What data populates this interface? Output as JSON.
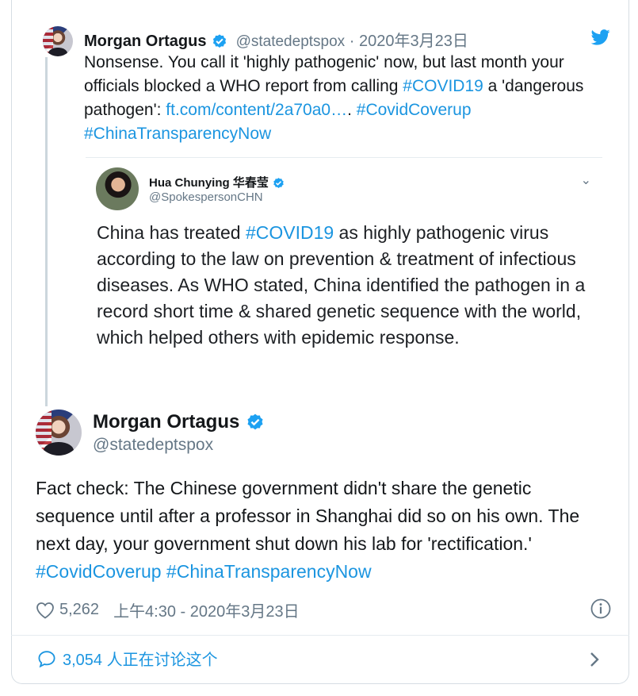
{
  "quoted_reply": {
    "name": "Morgan Ortagus",
    "handle": "@statedeptspox",
    "separator": "·",
    "date": "2020年3月23日",
    "text_1": "Nonsense. You call it 'highly pathogenic' now, but last month your officials blocked a WHO report from calling ",
    "hashtag_1": "#COVID19",
    "text_2": " a 'dangerous pathogen': ",
    "link": "ft.com/content/2a70a0…",
    "text_3": ". ",
    "hashtag_2": "#CovidCoverup",
    "hashtag_3": "#ChinaTransparencyNow"
  },
  "embedded_tweet": {
    "name": "Hua Chunying 华春莹",
    "handle": "@SpokespersonCHN",
    "text_1": "China has treated ",
    "hashtag": "#COVID19",
    "text_2": " as highly pathogenic virus according to the law on prevention & treatment of infectious diseases. As WHO stated, China identified the pathogen in a record short time & shared genetic sequence with the world, which helped others with epidemic response."
  },
  "main_tweet": {
    "name": "Morgan Ortagus",
    "handle": "@statedeptspox",
    "text": "Fact check: The Chinese government didn't share the genetic sequence until after a professor in Shanghai did so on his own. The next day, your government shut down his lab for 'rectification.' ",
    "hashtag_1": "#CovidCoverup",
    "hashtag_2": "#ChinaTransparencyNow",
    "likes": "5,262",
    "timestamp": "上午4:30 - 2020年3月23日"
  },
  "footer": {
    "replies_label": "3,054 人正在讨论这个"
  },
  "colors": {
    "link": "#1b95e0",
    "muted": "#657786",
    "verified": "#1da1f2"
  },
  "icons": [
    "twitter-bird-icon",
    "verified-badge-icon",
    "heart-icon",
    "info-icon",
    "reply-bubble-icon",
    "chevron-right-icon",
    "chevron-down-icon"
  ]
}
